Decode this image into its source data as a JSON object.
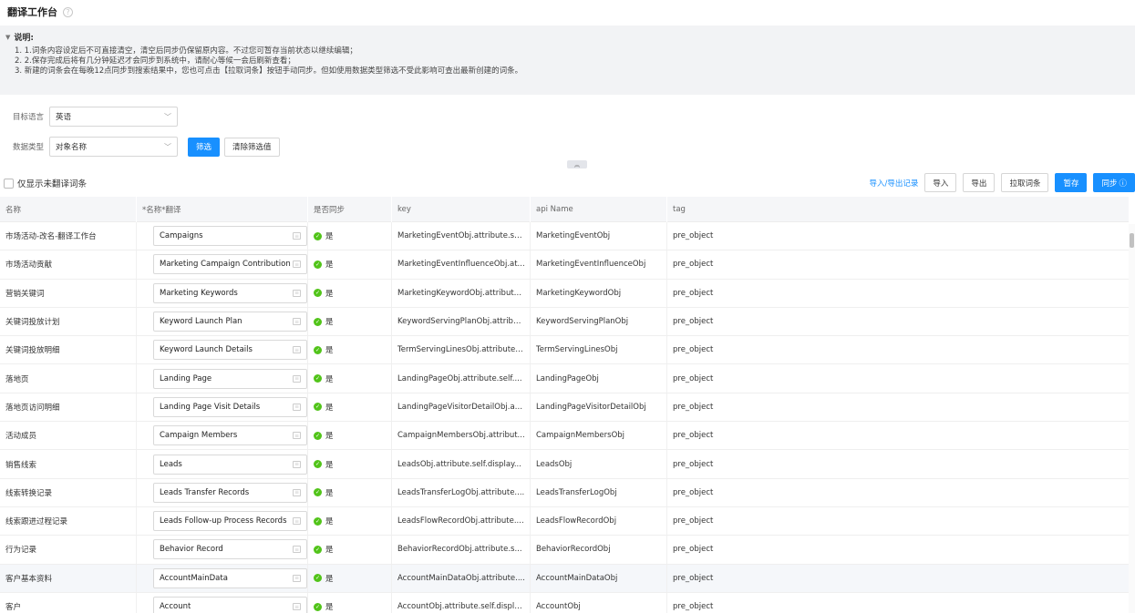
{
  "header": {
    "title": "翻译工作台",
    "help_icon": "?"
  },
  "notes": {
    "title": "说明:",
    "lines": [
      "1. 1.词条内容设定后不可直接清空，清空后同步仍保留原内容。不过您可暂存当前状态以继续编辑；",
      "2. 2.保存完成后将有几分钟延迟才会同步到系统中，请耐心等候一会后刷新查看；",
      "3. 新建的词条会在每晚12点同步到搜索结果中，您也可点击【拉取词条】按钮手动同步。但如使用数据类型筛选不受此影响可查出最新创建的词条。"
    ]
  },
  "filters": {
    "target_lang_label": "目标语言",
    "target_lang_value": "英语",
    "data_type_label": "数据类型",
    "data_type_value": "对象名称",
    "filter_btn": "筛选",
    "clear_btn": "清除筛选值"
  },
  "toolbar": {
    "only_untranslated": "仅显示未翻译词条",
    "io_records": "导入/导出记录",
    "import": "导入",
    "export": "导出",
    "pull": "拉取词条",
    "save": "暂存",
    "sync": "同步"
  },
  "table": {
    "headers": [
      "名称",
      "*名称*翻译",
      "是否同步",
      "key",
      "api Name",
      "tag"
    ],
    "sync_yes": "是",
    "rows": [
      {
        "name": "市场活动-改名-翻译工作台",
        "translation": "Campaigns",
        "key": "MarketingEventObj.attribute.se...",
        "api": "MarketingEventObj",
        "tag": "pre_object"
      },
      {
        "name": "市场活动贡献",
        "translation": "Marketing Campaign Contribution",
        "key": "MarketingEventInfluenceObj.at...",
        "api": "MarketingEventInfluenceObj",
        "tag": "pre_object"
      },
      {
        "name": "营销关键词",
        "translation": "Marketing Keywords",
        "key": "MarketingKeywordObj.attribute...",
        "api": "MarketingKeywordObj",
        "tag": "pre_object"
      },
      {
        "name": "关键词投放计划",
        "translation": "Keyword Launch Plan",
        "key": "KeywordServingPlanObj.attribu...",
        "api": "KeywordServingPlanObj",
        "tag": "pre_object"
      },
      {
        "name": "关键词投放明细",
        "translation": "Keyword Launch Details",
        "key": "TermServingLinesObj.attribute....",
        "api": "TermServingLinesObj",
        "tag": "pre_object"
      },
      {
        "name": "落地页",
        "translation": "Landing Page",
        "key": "LandingPageObj.attribute.self....",
        "api": "LandingPageObj",
        "tag": "pre_object"
      },
      {
        "name": "落地页访问明细",
        "translation": "Landing Page Visit Details",
        "key": "LandingPageVisitorDetailObj.at...",
        "api": "LandingPageVisitorDetailObj",
        "tag": "pre_object"
      },
      {
        "name": "活动成员",
        "translation": "Campaign Members",
        "key": "CampaignMembersObj.attribut...",
        "api": "CampaignMembersObj",
        "tag": "pre_object"
      },
      {
        "name": "销售线索",
        "translation": "Leads",
        "key": "LeadsObj.attribute.self.display...",
        "api": "LeadsObj",
        "tag": "pre_object"
      },
      {
        "name": "线索转换记录",
        "translation": "Leads Transfer Records",
        "key": "LeadsTransferLogObj.attribute....",
        "api": "LeadsTransferLogObj",
        "tag": "pre_object"
      },
      {
        "name": "线索跟进过程记录",
        "translation": "Leads Follow-up Process Records",
        "key": "LeadsFlowRecordObj.attribute....",
        "api": "LeadsFlowRecordObj",
        "tag": "pre_object"
      },
      {
        "name": "行为记录",
        "translation": "Behavior Record",
        "key": "BehaviorRecordObj.attribute.s...",
        "api": "BehaviorRecordObj",
        "tag": "pre_object"
      },
      {
        "name": "客户基本资料",
        "translation": "AccountMainData",
        "key": "AccountMainDataObj.attribute....",
        "api": "AccountMainDataObj",
        "tag": "pre_object"
      },
      {
        "name": "客户",
        "translation": "Account",
        "key": "AccountObj.attribute.self.displa...",
        "api": "AccountObj",
        "tag": "pre_object"
      }
    ]
  }
}
